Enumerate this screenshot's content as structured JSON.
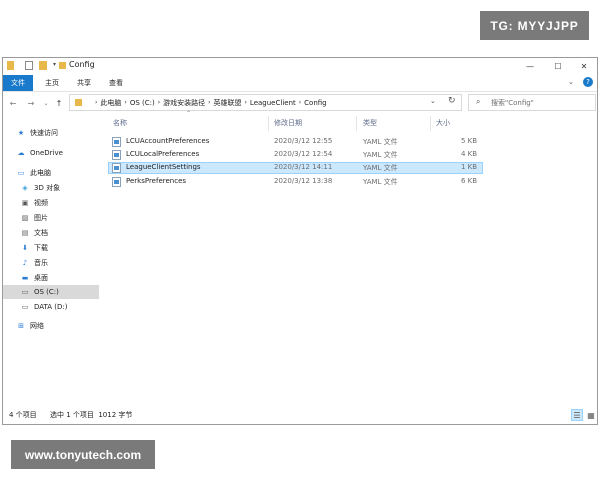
{
  "watermarks": {
    "top_right": "TG: MYYJJPP",
    "bottom_left": "www.tonyutech.com"
  },
  "window": {
    "title": "Config",
    "minimize_icon": "minimize-icon",
    "maximize_icon": "maximize-icon",
    "close_icon": "close-icon"
  },
  "ribbon": {
    "tabs": [
      "文件",
      "主页",
      "共享",
      "查看"
    ]
  },
  "address": {
    "crumbs": [
      "此电脑",
      "OS (C:)",
      "游戏安装路径",
      "英雄联盟",
      "LeagueClient",
      "Config"
    ],
    "search_placeholder": "搜索\"Config\""
  },
  "nav": {
    "items": [
      {
        "label": "快速访问",
        "icon": "star-icon"
      },
      {
        "label": "OneDrive",
        "icon": "cloud-icon"
      },
      {
        "label": "此电脑",
        "icon": "computer-icon"
      },
      {
        "label": "3D 对象",
        "icon": "cube-icon"
      },
      {
        "label": "视频",
        "icon": "video-icon"
      },
      {
        "label": "图片",
        "icon": "picture-icon"
      },
      {
        "label": "文档",
        "icon": "document-icon"
      },
      {
        "label": "下载",
        "icon": "download-icon"
      },
      {
        "label": "音乐",
        "icon": "music-icon"
      },
      {
        "label": "桌面",
        "icon": "desktop-icon"
      },
      {
        "label": "OS (C:)",
        "icon": "drive-icon"
      },
      {
        "label": "DATA (D:)",
        "icon": "drive-icon"
      },
      {
        "label": "网络",
        "icon": "network-icon"
      }
    ]
  },
  "files": {
    "columns": [
      "名称",
      "修改日期",
      "类型",
      "大小"
    ],
    "rows": [
      {
        "name": "LCUAccountPreferences",
        "date": "2020/3/12 12:55",
        "type": "YAML 文件",
        "size": "5 KB"
      },
      {
        "name": "LCULocalPreferences",
        "date": "2020/3/12 12:54",
        "type": "YAML 文件",
        "size": "4 KB"
      },
      {
        "name": "LeagueClientSettings",
        "date": "2020/3/12 14:11",
        "type": "YAML 文件",
        "size": "1 KB",
        "selected": true
      },
      {
        "name": "PerksPreferences",
        "date": "2020/3/12 13:38",
        "type": "YAML 文件",
        "size": "6 KB"
      }
    ]
  },
  "status": {
    "count": "4 个项目",
    "selection": "选中 1 个项目  1012 字节"
  }
}
